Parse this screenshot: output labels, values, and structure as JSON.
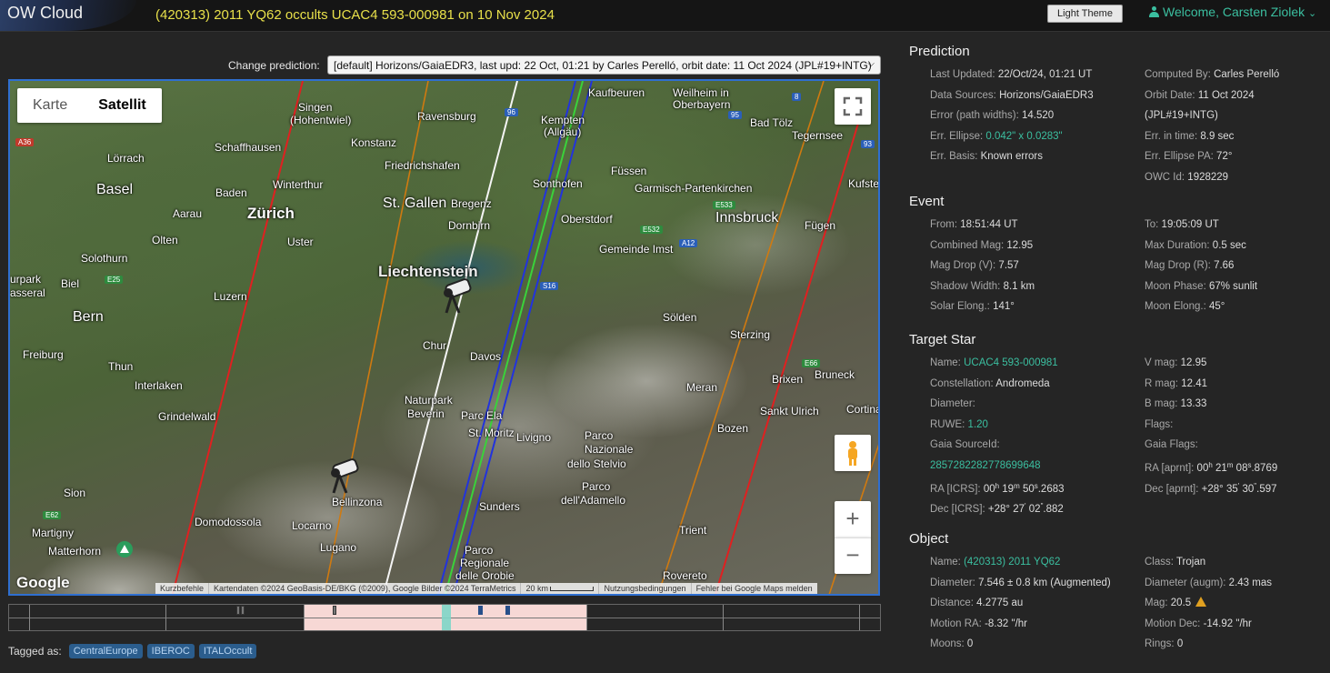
{
  "header": {
    "logo": "OW Cloud",
    "title": "(420313) 2011 YQ62 occults UCAC4 593-000981 on 10 Nov 2024",
    "theme_button": "Light Theme",
    "welcome": "Welcome, Carsten Ziolek"
  },
  "prediction_selector": {
    "label": "Change prediction:",
    "value": "[default] Horizons/GaiaEDR3, last upd: 22 Oct, 01:21 by Carles Perelló, orbit date: 11 Oct 2024 (JPL#19+INTG)"
  },
  "map": {
    "type_buttons": [
      "Karte",
      "Satellit"
    ],
    "selected_type": "Satellit",
    "google": "Google",
    "attribution": [
      "Kurzbefehle",
      "Kartendaten ©2024 GeoBasis-DE/BKG (©2009), Google Bilder ©2024 TerraMetrics",
      "20 km",
      "Nutzungsbedingungen",
      "Fehler bei Google Maps melden"
    ],
    "labels": {
      "singen": "Singen",
      "hohentwiel": "(Hohentwiel)",
      "ravensburg": "Ravensburg",
      "kaufbeuren": "Kaufbeuren",
      "weilheim": "Weilheim in",
      "oberbayern": "Oberbayern",
      "schaffhausen": "Schaffhausen",
      "konstanz": "Konstanz",
      "kempten": "Kempten",
      "allgaeu": "(Allgäu)",
      "badtoelz": "Bad Tölz",
      "tegernsee": "Tegernsee",
      "loerrach": "Lörrach",
      "friedrichshafen": "Friedrichshafen",
      "fuessen": "Füssen",
      "basel": "Basel",
      "baden": "Baden",
      "winterthur": "Winterthur",
      "sonthofen": "Sonthofen",
      "garmisch": "Garmisch-Partenkirchen",
      "kufstein": "Kufste",
      "stgallen": "St. Gallen",
      "bregenz": "Bregenz",
      "aarau": "Aarau",
      "zuerich": "Zürich",
      "dornbirn": "Dornbirn",
      "oberstdorf": "Oberstdorf",
      "olten": "Olten",
      "uster": "Uster",
      "innsbruck": "Innsbruck",
      "fuegen": "Fügen",
      "gemeindeimst": "Gemeinde Imst",
      "liechtenstein": "Liechtenstein",
      "solothurn": "Solothurn",
      "urpark": "urpark",
      "asseral": "asseral",
      "biel": "Biel",
      "luzern": "Luzern",
      "bern": "Bern",
      "solden": "Sölden",
      "sterzing": "Sterzing",
      "chur": "Chur",
      "davos": "Davos",
      "freiburg": "Freiburg",
      "thun": "Thun",
      "interlaken": "Interlaken",
      "meran": "Meran",
      "brixen": "Brixen",
      "bruneck": "Bruneck",
      "naturpark": "Naturpark",
      "beverin": "Beverin",
      "parcoela": "Parc Ela",
      "livigno": "Livigno",
      "parconaz": "Parco",
      "parconaz2": "Nazionale",
      "parconaz3": "dello Stelvio",
      "grindelwald": "Grindelwald",
      "stmoritz": "St. Moritz",
      "bozen": "Bozen",
      "cortina": "Cortina",
      "sanktulrich": "Sankt Ulrich",
      "bellinzona": "Bellinzona",
      "sion": "Sion",
      "parcoadamello": "Parco",
      "parcoadamello2": "dell'Adamello",
      "sunders": "Sunders",
      "trient": "Trient",
      "domodossola": "Domodossola",
      "locarno": "Locarno",
      "martigny": "Martigny",
      "lugano": "Lugano",
      "parcoorobie": "Parco",
      "parcoorobie2": "Regionale",
      "parcoorobie3": "delle Orobie",
      "rovereto": "Rovereto",
      "matterhorn": "Matterhorn"
    },
    "roads": [
      "A36",
      "96",
      "95",
      "8",
      "93",
      "E25",
      "E532",
      "E533",
      "A12",
      "S16",
      "E66",
      "E62"
    ]
  },
  "timeline": {},
  "tags": {
    "label": "Tagged as:",
    "items": [
      "CentralEurope",
      "IBEROC",
      "ITALOccult"
    ]
  },
  "panel": {
    "prediction": {
      "title": "Prediction",
      "left": [
        {
          "k": "Last Updated:",
          "v": "22/Oct/24, 01:21 UT"
        },
        {
          "k": "Data Sources:",
          "v": "Horizons/GaiaEDR3"
        },
        {
          "k": "Error (path widths):",
          "v": "14.520"
        },
        {
          "k": "Err. Ellipse:",
          "v": "0.042\" x 0.0283\""
        },
        {
          "k": "Err. Basis:",
          "v": "Known errors"
        }
      ],
      "right": [
        {
          "k": "Computed By:",
          "v": "Carles Perelló"
        },
        {
          "k": "Orbit Date:",
          "v": "11 Oct 2024"
        },
        {
          "k": "",
          "v": "(JPL#19+INTG)"
        },
        {
          "k": "Err. in time:",
          "v": "8.9 sec"
        },
        {
          "k": "Err. Ellipse PA:",
          "v": "72°"
        },
        {
          "k": "OWC Id:",
          "v": "1928229"
        }
      ]
    },
    "event": {
      "title": "Event",
      "left": [
        {
          "k": "From:",
          "v": "18:51:44 UT"
        },
        {
          "k": "Combined Mag:",
          "v": "12.95"
        },
        {
          "k": "Mag Drop (V):",
          "v": "7.57"
        },
        {
          "k": "Shadow Width:",
          "v": "8.1 km"
        },
        {
          "k": "Solar Elong.:",
          "v": "141°"
        }
      ],
      "right": [
        {
          "k": "To:",
          "v": "19:05:09 UT"
        },
        {
          "k": "Max Duration:",
          "v": "0.5 sec"
        },
        {
          "k": "Mag Drop (R):",
          "v": "7.66"
        },
        {
          "k": "Moon Phase:",
          "v": "67% sunlit"
        },
        {
          "k": "Moon Elong.:",
          "v": "45°"
        }
      ]
    },
    "star": {
      "title": "Target Star",
      "name_k": "Name:",
      "name_v": "UCAC4 593-000981",
      "constellation_k": "Constellation:",
      "constellation_v": "Andromeda",
      "diameter_k": "Diameter:",
      "ruwe_k": "RUWE:",
      "ruwe_v": "1.20",
      "gaia_k": "Gaia SourceId:",
      "gaia_v": "2857282282778699648",
      "ra_k": "RA [ICRS]:",
      "ra_h": "00",
      "ra_m": "19",
      "ra_s": "50",
      "ra_f": ".2683",
      "dec_k": "Dec [ICRS]:",
      "dec_d": "+28°",
      "dec_m": "27",
      "dec_s": "02",
      "dec_f": ".882",
      "vmag_k": "V mag:",
      "vmag_v": "12.95",
      "rmag_k": "R mag:",
      "rmag_v": "12.41",
      "bmag_k": "B mag:",
      "bmag_v": "13.33",
      "flags_k": "Flags:",
      "gaiaflags_k": "Gaia Flags:",
      "raa_k": "RA [aprnt]:",
      "raa_h": "00",
      "raa_m": "21",
      "raa_s": "08",
      "raa_f": ".8769",
      "deca_k": "Dec [aprnt]:",
      "deca_d": "+28°",
      "deca_m": "35",
      "deca_s": "30",
      "deca_f": ".597",
      "unit_h": "h",
      "unit_m": "m",
      "unit_s": "s",
      "unit_am": "'",
      "unit_as": "\""
    },
    "object": {
      "title": "Object",
      "left": [
        {
          "k": "Name:",
          "v": "(420313) 2011 YQ62"
        },
        {
          "k": "Diameter:",
          "v": "7.546 ± 0.8 km (Augmented)"
        },
        {
          "k": "Distance:",
          "v": "4.2775 au"
        },
        {
          "k": "Motion RA:",
          "v": "-8.32 \"/hr"
        },
        {
          "k": "Moons:",
          "v": "0"
        }
      ],
      "right": [
        {
          "k": "Class:",
          "v": "Trojan"
        },
        {
          "k": "Diameter (augm):",
          "v": "2.43 mas"
        },
        {
          "k": "Mag:",
          "v": "20.5"
        },
        {
          "k": "Motion Dec:",
          "v": "-14.92 \"/hr"
        },
        {
          "k": "Rings:",
          "v": "0"
        }
      ]
    }
  },
  "colors": {
    "accent": "#3bbfa0",
    "title": "#e8e04a",
    "map_border": "#2f6fd0",
    "path_central": "#3ad23a",
    "path_limit": "#2233dd",
    "path_error": "#e02020",
    "path_sigma": "#d07a10",
    "path_other": "#f5f5f5"
  }
}
